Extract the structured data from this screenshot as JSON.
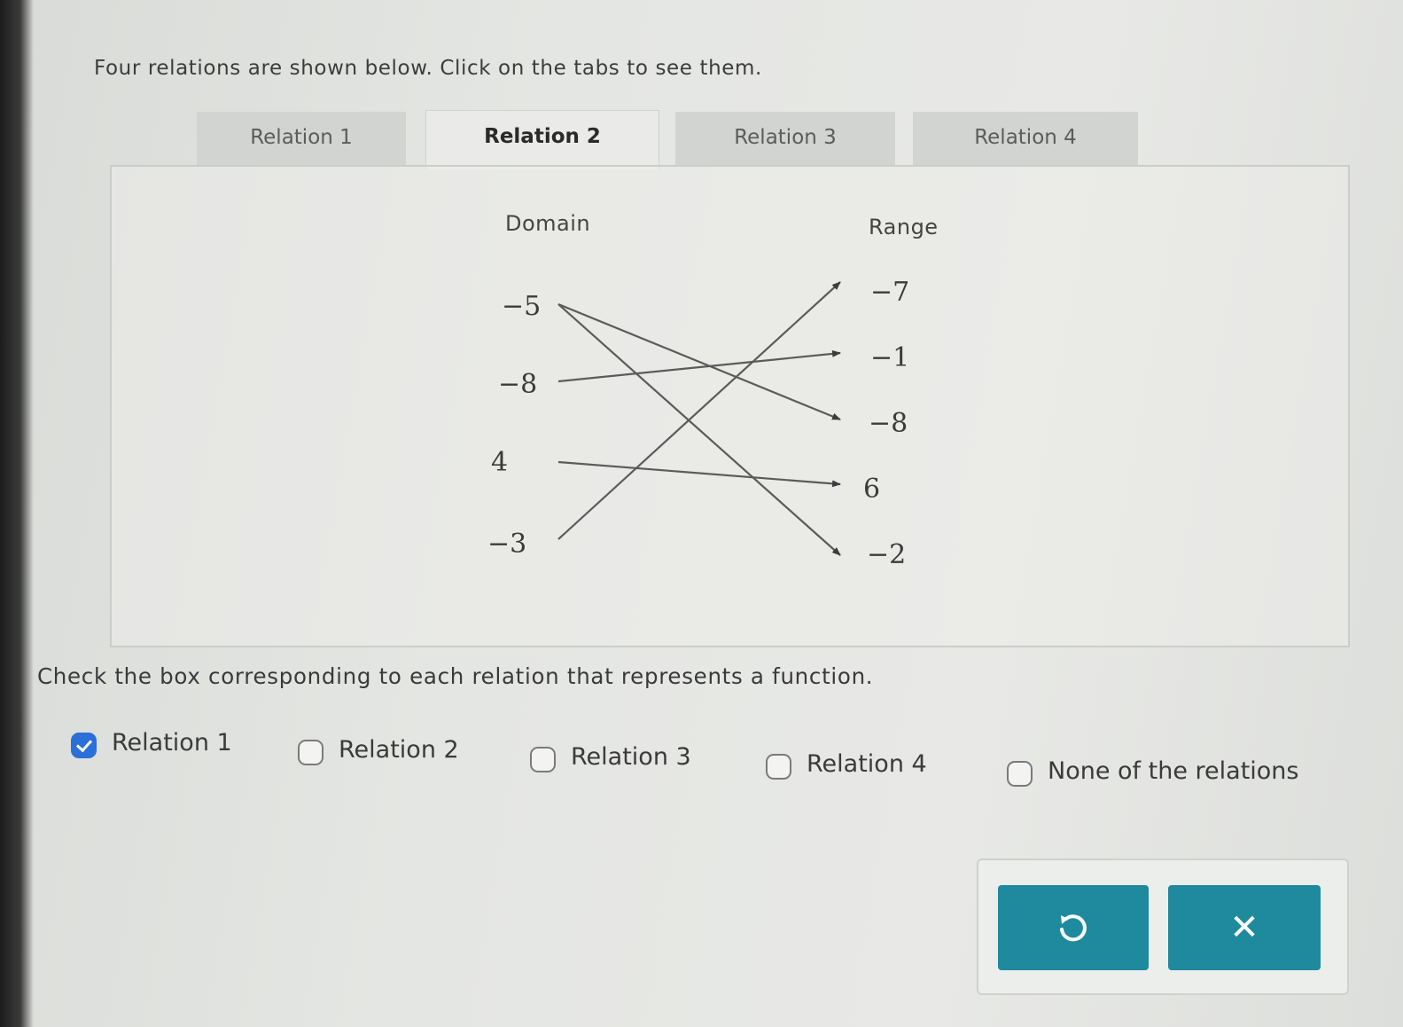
{
  "instruction": "Four relations are shown below. Click on the tabs to see them.",
  "tabs": [
    {
      "label": "Relation 1",
      "active": false
    },
    {
      "label": "Relation 2",
      "active": true
    },
    {
      "label": "Relation 3",
      "active": false
    },
    {
      "label": "Relation 4",
      "active": false
    }
  ],
  "mapping": {
    "domain_header": "Domain",
    "range_header": "Range",
    "domain": [
      "−5",
      "−8",
      "4",
      "−3"
    ],
    "range": [
      "−7",
      "−1",
      "−8",
      "6",
      "−2"
    ],
    "arrows": [
      {
        "from": "−5",
        "to": "−8"
      },
      {
        "from": "−5",
        "to": "−2"
      },
      {
        "from": "−8",
        "to": "−1"
      },
      {
        "from": "4",
        "to": "6"
      },
      {
        "from": "−3",
        "to": "−7"
      }
    ]
  },
  "question": "Check the box corresponding to each relation that represents a function.",
  "options": [
    {
      "label": "Relation 1",
      "checked": true
    },
    {
      "label": "Relation 2",
      "checked": false
    },
    {
      "label": "Relation 3",
      "checked": false
    },
    {
      "label": "Relation 4",
      "checked": false
    },
    {
      "label": "None of the relations",
      "checked": false
    }
  ],
  "actions": {
    "undo_icon": "undo-icon",
    "clear_icon": "close-icon",
    "clear_glyph": "✕",
    "color": "#1f8a9d"
  }
}
